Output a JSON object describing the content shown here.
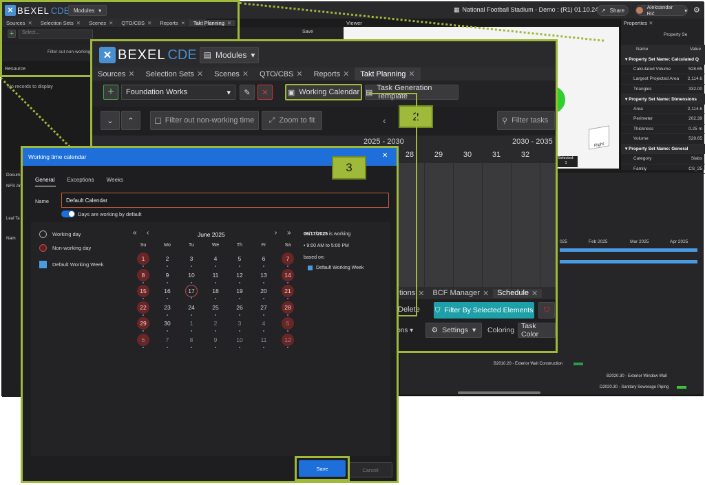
{
  "app": {
    "logo_left": "BEXEL",
    "logo_right": "CDE",
    "modules_label": "Modules",
    "project_title": "National Football Stadium - Demo : (R1) 01.10.24",
    "share_label": "Share",
    "user_name": "Aleksandar Rić"
  },
  "back_panel": {
    "tabs": [
      "Sources",
      "Selection Sets",
      "Scenes",
      "QTO/CBS",
      "Reports",
      "Takt Planning"
    ],
    "select_placeholder": "Select...",
    "filter_label": "Filter out non-working",
    "save_label": "Save",
    "working_calendar_label": "Working Calendar",
    "task_gen_label": "Task Generation Template",
    "resource_header": "Resource",
    "no_records": "No records to display",
    "viewer_tab": "Viewer",
    "doc_tab": "Docum",
    "nfs_label": "NFS Ar",
    "leaf_label": "Leaf Ta",
    "name_col": "Nam"
  },
  "properties": {
    "title": "Properties",
    "col_name": "Name",
    "col_value": "Value",
    "property_set_btn": "Property Se",
    "sections": [
      {
        "title": "Property Set Name: Calculated Q",
        "rows": [
          {
            "name": "Calculated Volume",
            "value": "528.65"
          },
          {
            "name": "Largest Projected Area",
            "value": "2,114.6"
          },
          {
            "name": "Triangles",
            "value": "332.00"
          }
        ]
      },
      {
        "title": "Property Set Name: Dimensions",
        "rows": [
          {
            "name": "Area",
            "value": "2,114.6"
          },
          {
            "name": "Perimeter",
            "value": "202.39"
          },
          {
            "name": "Thickness",
            "value": "0.25 m"
          },
          {
            "name": "Volume",
            "value": "528.65"
          }
        ]
      },
      {
        "title": "Property Set Name: General",
        "rows": [
          {
            "name": "Category",
            "value": "Slabs"
          },
          {
            "name": "Family",
            "value": "CS_25"
          }
        ]
      }
    ]
  },
  "viewer": {
    "cube_label": "Right",
    "selected_label": "Selected:",
    "selected_count": "1"
  },
  "zoom": {
    "tabs": [
      "Sources",
      "Selection Sets",
      "Scenes",
      "QTO/CBS",
      "Reports",
      "Takt Planning"
    ],
    "project_select": "Foundation Works",
    "working_calendar_label": "Working Calendar",
    "task_gen_label": "Task Generation Template",
    "filter_label": "Filter out non-working time",
    "zoom_fit_label": "Zoom to fit",
    "filter_tasks_label": "Filter tasks",
    "timeline_groups": [
      "2025 - 2030",
      "2030 - 2035"
    ],
    "timeline_days": [
      "28",
      "29",
      "30",
      "31",
      "32"
    ]
  },
  "schedule_panel": {
    "tabs": [
      "tions",
      "BCF Manager",
      "Schedule"
    ],
    "delete_label": "Delete",
    "filter_selected_label": "Filter By Selected Elements",
    "options_label": "ions",
    "settings_label": "Settings",
    "coloring_label": "Coloring",
    "task_color_label": "Task Color",
    "months": [
      "Feb 2025",
      "Mar 2025",
      "Apr 2025"
    ],
    "month_partial": "025",
    "tasks": [
      "B2010.20 - Exterior Wall Construction",
      "B2020.30 - Exterior Window Wall",
      "D2020.30 - Sanitary Sewerage Piping"
    ]
  },
  "dialog": {
    "title": "Working time calendar",
    "tabs": [
      "General",
      "Exceptions",
      "Weeks"
    ],
    "name_label": "Name",
    "name_value": "Default Calendar",
    "toggle_label": "Days are working by default",
    "legend": [
      "Working day",
      "Non-working day",
      "Default Working Week"
    ],
    "month_title": "June 2025",
    "weekdays": [
      "Su",
      "Mo",
      "Tu",
      "We",
      "Th",
      "Fr",
      "Sa"
    ],
    "weeks": [
      [
        "1",
        "2",
        "3",
        "4",
        "5",
        "6",
        "7"
      ],
      [
        "8",
        "9",
        "10",
        "11",
        "12",
        "13",
        "14"
      ],
      [
        "15",
        "16",
        "17",
        "18",
        "19",
        "20",
        "21"
      ],
      [
        "22",
        "23",
        "24",
        "25",
        "26",
        "27",
        "28"
      ],
      [
        "29",
        "30",
        "1",
        "2",
        "3",
        "4",
        "5"
      ],
      [
        "6",
        "7",
        "8",
        "9",
        "10",
        "11",
        "12"
      ]
    ],
    "info_date": "06/17/2025",
    "info_suffix": " is working",
    "info_hours": "9:00 AM to 5:00 PM",
    "info_based_on": "based on:",
    "info_week": "Default Working Week",
    "save_label": "Save",
    "cancel_label": "Cancel"
  },
  "callouts": [
    "2",
    "3"
  ],
  "colors": {
    "accent_green": "#9fb93a",
    "dialog_blue": "#1e6fd9",
    "teal": "#1ea0a8",
    "nonworking": "#6a2626"
  }
}
